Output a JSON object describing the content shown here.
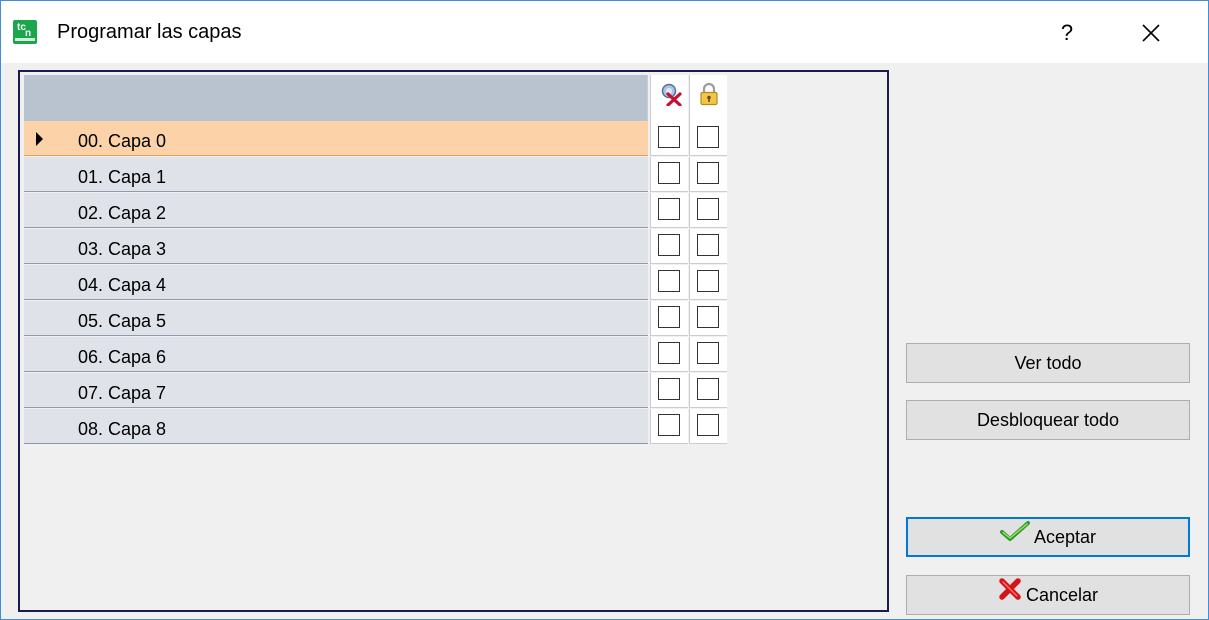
{
  "window": {
    "title": "Programar las capas",
    "help_label": "?",
    "app_icon_text_1": "tc",
    "app_icon_text_2": "n"
  },
  "grid": {
    "header_icons": [
      "visibility-off-icon",
      "lock-icon"
    ],
    "rows": [
      {
        "label": "00. Capa 0",
        "selected": true,
        "hidden": false,
        "locked": false
      },
      {
        "label": "01. Capa 1",
        "selected": false,
        "hidden": false,
        "locked": false
      },
      {
        "label": "02. Capa 2",
        "selected": false,
        "hidden": false,
        "locked": false
      },
      {
        "label": "03. Capa 3",
        "selected": false,
        "hidden": false,
        "locked": false
      },
      {
        "label": "04. Capa 4",
        "selected": false,
        "hidden": false,
        "locked": false
      },
      {
        "label": "05. Capa 5",
        "selected": false,
        "hidden": false,
        "locked": false
      },
      {
        "label": "06. Capa 6",
        "selected": false,
        "hidden": false,
        "locked": false
      },
      {
        "label": "07. Capa 7",
        "selected": false,
        "hidden": false,
        "locked": false
      },
      {
        "label": "08. Capa 8",
        "selected": false,
        "hidden": false,
        "locked": false
      }
    ]
  },
  "buttons": {
    "show_all": "Ver todo",
    "unlock_all": "Desbloquear todo",
    "accept": "Aceptar",
    "cancel": "Cancelar"
  },
  "colors": {
    "selected_row": "#fcd3a8",
    "header": "#b9c3cf",
    "row": "#dfe3e9",
    "default_button_border": "#0078d7"
  }
}
